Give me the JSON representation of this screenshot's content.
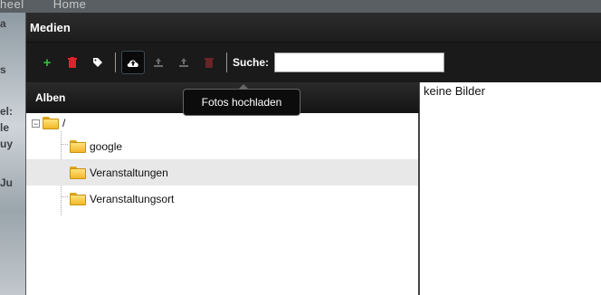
{
  "background": {
    "top_items": [
      "heel",
      "Home"
    ],
    "side_fragments": [
      "a",
      "s",
      "el:",
      "le",
      "uy",
      "Ju"
    ]
  },
  "dialog": {
    "title": "Medien"
  },
  "toolbar": {
    "buttons": [
      {
        "name": "add-icon",
        "glyph": "+",
        "color": "#2fbf3a"
      },
      {
        "name": "delete-icon",
        "glyph": "■",
        "color": "#d9262c"
      },
      {
        "name": "edit-tag-icon",
        "glyph": "✎",
        "color": "#ffffff"
      },
      {
        "name": "upload-cloud-icon",
        "glyph": "☁",
        "color": "#ffffff"
      },
      {
        "name": "import-icon",
        "glyph": "⇩",
        "color": "#6b6b6b"
      },
      {
        "name": "download-icon",
        "glyph": "⇩",
        "color": "#6b6b6b"
      },
      {
        "name": "trash-icon",
        "glyph": "■",
        "color": "#6a2326"
      }
    ],
    "search_label": "Suche:",
    "search_value": ""
  },
  "tooltip": {
    "text": "Fotos hochladen"
  },
  "albums": {
    "header": "Alben",
    "root": "/",
    "root_toggle": "−",
    "children": [
      {
        "label": "google",
        "selected": false
      },
      {
        "label": "Veranstaltungen",
        "selected": true
      },
      {
        "label": "Veranstaltungsort",
        "selected": false
      }
    ]
  },
  "images": {
    "empty_text": "keine Bilder"
  }
}
